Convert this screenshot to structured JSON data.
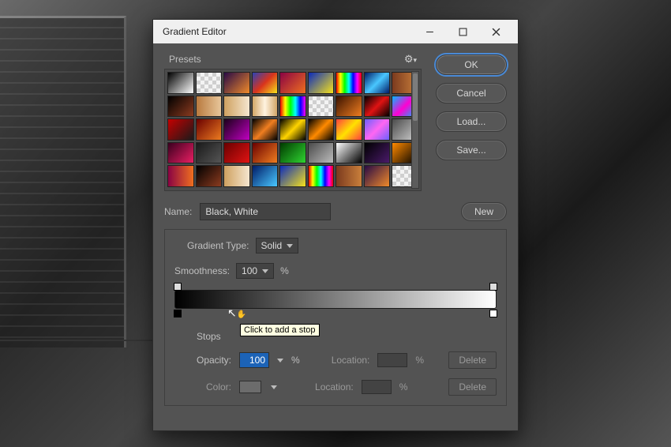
{
  "window": {
    "title": "Gradient Editor"
  },
  "buttons": {
    "ok": "OK",
    "cancel": "Cancel",
    "load": "Load...",
    "save": "Save...",
    "new": "New",
    "delete": "Delete"
  },
  "presets": {
    "label": "Presets",
    "swatches": [
      "linear-gradient(135deg,#000,#fff)",
      "repeating-conic-gradient(#f3f3f3 0 25%,#cfcfcf 0 50%) 0 0/10px 10px",
      "linear-gradient(135deg,#280a45,#f08a2a)",
      "linear-gradient(135deg,#2b43b5,#d9341c,#f6e21b)",
      "linear-gradient(135deg,#8a0343,#f06f1f)",
      "linear-gradient(135deg,#0b2bbc,#f6e21b)",
      "linear-gradient(90deg,#e00,#ff0,#0f0,#0ff,#00f,#f0f,#e00)",
      "linear-gradient(135deg,#001b66,#49c7ff,#001b66)",
      "linear-gradient(90deg,#7b3a1e,#c97f3b)",
      "linear-gradient(135deg,#000,#8c3b1f)",
      "linear-gradient(90deg,#b97a3f,#e7c69a)",
      "linear-gradient(90deg,#cfa160,#f5e6cf)",
      "linear-gradient(90deg,#d2a667,#fff3e0,#d2a667)",
      "linear-gradient(90deg,#e00,#ff0,#0f0,#0ff,#00f,#f0f)",
      "repeating-conic-gradient(#f3f3f3 0 25%,#cfcfcf 0 50%) 0 0/10px 10px",
      "linear-gradient(135deg,#3a1200,#f07e20)",
      "linear-gradient(135deg,#000,#e01313,#000)",
      "linear-gradient(135deg,#00b9ff,#ff00d1,#00b9ff)",
      "linear-gradient(135deg,#c40000,#1a1a1a)",
      "linear-gradient(135deg,#6a0000,#ec7b20)",
      "linear-gradient(135deg,#1a001a,#c100c1)",
      "linear-gradient(135deg,#000,#f07e20,#000)",
      "linear-gradient(135deg,#000,#ffd400,#000)",
      "linear-gradient(135deg,#000,#ff8a00,#000)",
      "linear-gradient(135deg,#ff4040,#ffe100,#ff4040)",
      "linear-gradient(135deg,#6a60ff,#ff66f2,#6a60ff)",
      "linear-gradient(135deg,#4b4b4b,#cfcfcf)",
      "linear-gradient(135deg,#3a001f,#e91e63)",
      "linear-gradient(135deg,#1a1a1a,#555)",
      "linear-gradient(135deg,#6a0000,#e01313)",
      "linear-gradient(135deg,#6a0000,#f07e20)",
      "linear-gradient(135deg,#003a00,#2fd431)",
      "linear-gradient(135deg,#4b4b4b,#bcbcbc)",
      "linear-gradient(135deg,#fff,#000)",
      "linear-gradient(135deg,#000,#4a1a6a)",
      "linear-gradient(135deg,#ff8a00,#000)",
      "linear-gradient(90deg,#8a0343,#f06f1f)",
      "linear-gradient(135deg,#000,#8c3b1f)",
      "linear-gradient(90deg,#cfa160,#f5e6cf)",
      "linear-gradient(135deg,#001b66,#49c7ff)",
      "linear-gradient(135deg,#0b2bbc,#f6e21b)",
      "linear-gradient(90deg,#e00,#ff0,#0f0,#0ff,#00f,#f0f,#e00)",
      "linear-gradient(90deg,#7b3a1e,#c97f3b)",
      "linear-gradient(135deg,#280a45,#f08a2a)",
      "repeating-conic-gradient(#f3f3f3 0 25%,#cfcfcf 0 50%) 0 0/10px 10px"
    ]
  },
  "name": {
    "label": "Name:",
    "value": "Black, White"
  },
  "gradientType": {
    "label": "Gradient Type:",
    "value": "Solid"
  },
  "smoothness": {
    "label": "Smoothness:",
    "value": "100",
    "unit": "%"
  },
  "stops": {
    "label": "Stops",
    "tooltip": "Click to add a stop",
    "opacity": {
      "label": "Opacity:",
      "value": "100",
      "unit": "%"
    },
    "location": {
      "label": "Location:",
      "unit": "%"
    },
    "color": {
      "label": "Color:"
    }
  }
}
